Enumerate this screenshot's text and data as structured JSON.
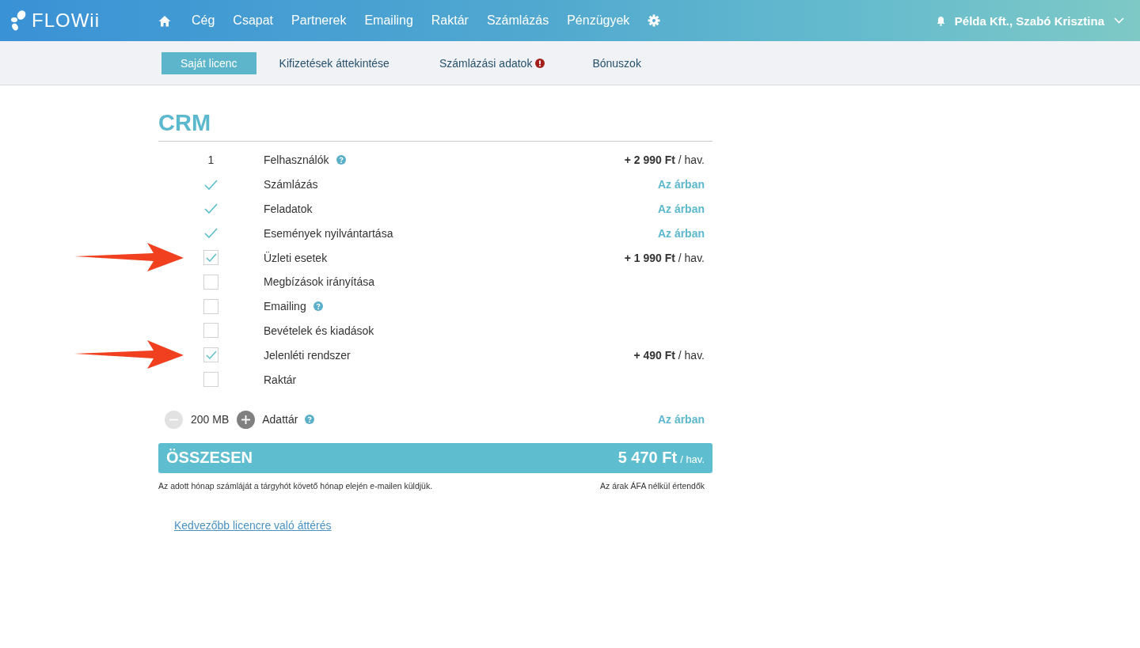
{
  "topbar": {
    "logo": "FLOWii",
    "nav": [
      {
        "label": "Cég"
      },
      {
        "label": "Csapat"
      },
      {
        "label": "Partnerek"
      },
      {
        "label": "Emailing"
      },
      {
        "label": "Raktár"
      },
      {
        "label": "Számlázás"
      },
      {
        "label": "Pénzügyek"
      }
    ],
    "account": "Példa Kft., Szabó Krisztina"
  },
  "tabs": [
    {
      "label": "Saját licenc",
      "selected": true,
      "alert": false
    },
    {
      "label": "Kifizetések áttekintése",
      "selected": false,
      "alert": false
    },
    {
      "label": "Számlázási adatok",
      "selected": false,
      "alert": true
    },
    {
      "label": "Bónuszok",
      "selected": false,
      "alert": false
    }
  ],
  "section": {
    "title": "CRM"
  },
  "features": [
    {
      "kind": "count",
      "count": "1",
      "label": "Felhasználók",
      "help": true,
      "price": "**+ 2 990 Ft** / hav.",
      "arrow": false
    },
    {
      "kind": "included",
      "label": "Számlázás",
      "help": false,
      "price_note": "Az árban",
      "arrow": false
    },
    {
      "kind": "included",
      "label": "Feladatok",
      "help": false,
      "price_note": "Az árban",
      "arrow": false
    },
    {
      "kind": "included",
      "label": "Események nyilvántartása",
      "help": false,
      "price_note": "Az árban",
      "arrow": false
    },
    {
      "kind": "checkbox",
      "checked": true,
      "label": "Üzleti esetek",
      "help": false,
      "price": "**+ 1 990 Ft** / hav.",
      "arrow": true
    },
    {
      "kind": "checkbox",
      "checked": false,
      "label": "Megbízások irányítása",
      "help": false,
      "arrow": false
    },
    {
      "kind": "checkbox",
      "checked": false,
      "label": "Emailing",
      "help": true,
      "arrow": false
    },
    {
      "kind": "checkbox",
      "checked": false,
      "label": "Bevételek és kiadások",
      "help": false,
      "arrow": false
    },
    {
      "kind": "checkbox",
      "checked": true,
      "label": "Jelenléti rendszer",
      "help": false,
      "price": "**+ 490 Ft** / hav.",
      "arrow": true
    },
    {
      "kind": "checkbox",
      "checked": false,
      "label": "Raktár",
      "help": false,
      "arrow": false
    }
  ],
  "storage": {
    "amount": "200 MB",
    "label": "Adattár",
    "help": true,
    "price_note": "Az árban",
    "minus_disabled": true
  },
  "total": {
    "label": "ÖSSZESEN",
    "amount": "5 470 Ft",
    "unit": "/ hav."
  },
  "footnotes": {
    "left": "Az adott hónap számláját a tárgyhót követő hónap elején e-mailen küldjük.",
    "right": "Az árak ÁFA nélkül értendők"
  },
  "link": "Kedvezőbb licencre való áttérés"
}
